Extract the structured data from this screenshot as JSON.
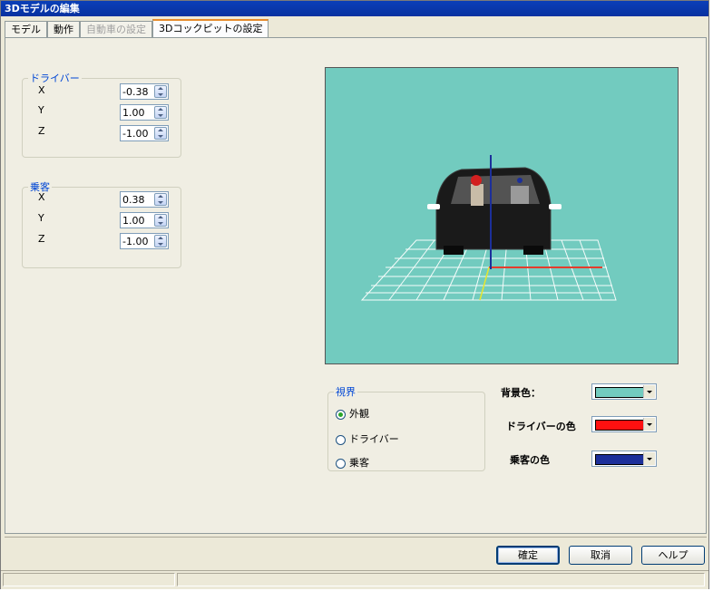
{
  "window": {
    "title": "3Dモデルの編集"
  },
  "tabs": [
    {
      "label": "モデル",
      "state": "normal"
    },
    {
      "label": "動作",
      "state": "normal"
    },
    {
      "label": "自動車の設定",
      "state": "disabled"
    },
    {
      "label": "3Dコックピットの設定",
      "state": "active"
    }
  ],
  "driver_group": {
    "label": "ドライバー",
    "fields": [
      {
        "axis": "X",
        "value": "-0.38"
      },
      {
        "axis": "Y",
        "value": "1.00"
      },
      {
        "axis": "Z",
        "value": "-1.00"
      }
    ]
  },
  "passenger_group": {
    "label": "乗客",
    "fields": [
      {
        "axis": "X",
        "value": "0.38"
      },
      {
        "axis": "Y",
        "value": "1.00"
      },
      {
        "axis": "Z",
        "value": "-1.00"
      }
    ]
  },
  "viewpoint_group": {
    "label": "視界",
    "options": [
      {
        "label": "外観",
        "selected": true
      },
      {
        "label": "ドライバー",
        "selected": false
      },
      {
        "label": "乗客",
        "selected": false
      }
    ]
  },
  "colors": {
    "background": {
      "label": "背景色：",
      "value": "#72cbbf"
    },
    "driver": {
      "label": "ドライバーの色",
      "value": "#ff1010"
    },
    "passenger": {
      "label": "乗客の色",
      "value": "#1c2f9a"
    }
  },
  "buttons": {
    "ok": "確定",
    "cancel": "取消",
    "help": "ヘルプ"
  }
}
